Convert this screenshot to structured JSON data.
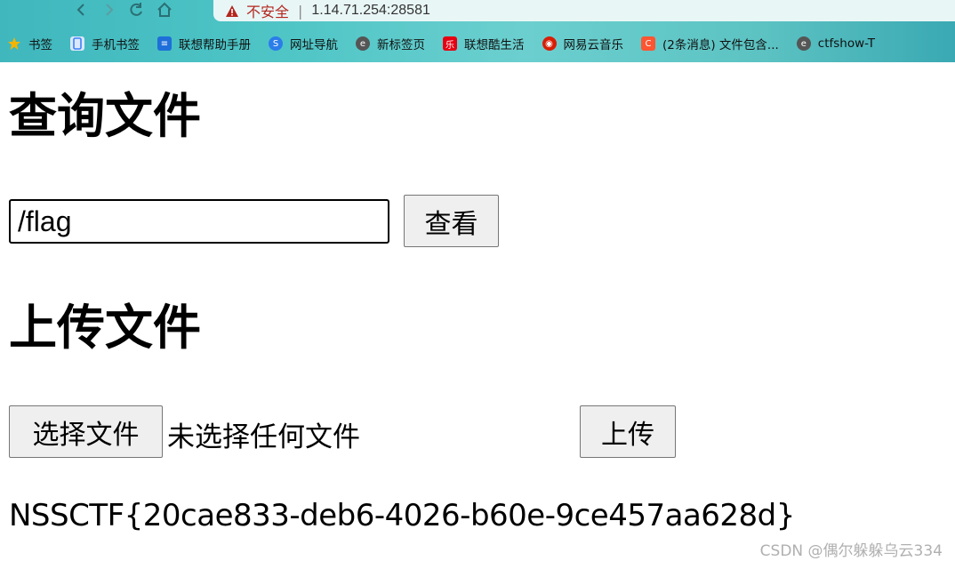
{
  "browser": {
    "security_label": "不安全",
    "separator": "|",
    "url": "1.14.71.254:28581",
    "bookmarks": [
      {
        "label": "书签",
        "icon": "star-icon",
        "color": "#f4b400"
      },
      {
        "label": "手机书签",
        "icon": "phone-icon",
        "color": "#3b82f6"
      },
      {
        "label": "联想帮助手册",
        "icon": "doc-icon",
        "color": "#1e6fd9"
      },
      {
        "label": "网址导航",
        "icon": "nav-s-icon",
        "color": "#2b7de9"
      },
      {
        "label": "新标签页",
        "icon": "e-icon",
        "color": "#555555"
      },
      {
        "label": "联想酷生活",
        "icon": "lenovo-icon",
        "color": "#e60012"
      },
      {
        "label": "网易云音乐",
        "icon": "netease-icon",
        "color": "#d81e06"
      },
      {
        "label": "(2条消息) 文件包含...",
        "icon": "csdn-icon",
        "color": "#fc5531"
      },
      {
        "label": "ctfshow-T",
        "icon": "e-icon",
        "color": "#555555"
      }
    ]
  },
  "query": {
    "heading": "查询文件",
    "input_value": "/flag",
    "button": "查看"
  },
  "upload": {
    "heading": "上传文件",
    "choose_button": "选择文件",
    "no_file_text": "未选择任何文件",
    "button": "上传"
  },
  "result": {
    "flag": "NSSCTF{20cae833-deb6-4026-b60e-9ce457aa628d}"
  },
  "watermark": "CSDN @偶尔躲躲乌云334"
}
